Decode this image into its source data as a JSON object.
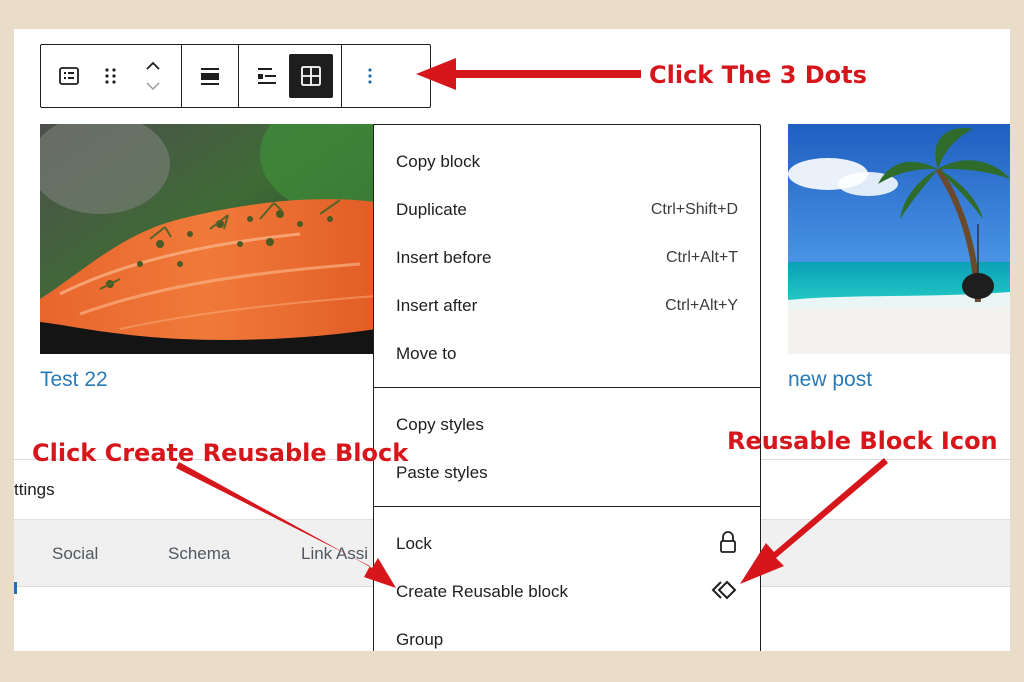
{
  "toolbar": {
    "buttons": [
      "block-type-icon",
      "drag-handle-icon",
      "move-up-down-icon",
      "align-icon",
      "list-view-icon",
      "grid-view-icon",
      "options-dots-icon"
    ]
  },
  "posts": [
    {
      "title": "Test 22"
    },
    {
      "title": "new post"
    }
  ],
  "menu": {
    "group1": [
      {
        "label": "Copy block",
        "shortcut": ""
      },
      {
        "label": "Duplicate",
        "shortcut": "Ctrl+Shift+D"
      },
      {
        "label": "Insert before",
        "shortcut": "Ctrl+Alt+T"
      },
      {
        "label": "Insert after",
        "shortcut": "Ctrl+Alt+Y"
      },
      {
        "label": "Move to",
        "shortcut": ""
      }
    ],
    "group2": [
      {
        "label": "Copy styles"
      },
      {
        "label": "Paste styles"
      }
    ],
    "group3": [
      {
        "label": "Lock",
        "icon": "lock-icon"
      },
      {
        "label": "Create Reusable block",
        "icon": "reusable-block-icon"
      },
      {
        "label": "Group"
      }
    ]
  },
  "settings": {
    "label": "ttings",
    "tabs": [
      "Social",
      "Schema",
      "Link Assi"
    ]
  },
  "annotations": {
    "click_dots": "Click The 3 Dots",
    "click_create": "Click Create Reusable Block",
    "reusable_icon": "Reusable Block Icon"
  },
  "colors": {
    "annotation": "#d6161b",
    "link": "#2a7ab5",
    "frame": "#e9dcc9",
    "active_button": "#1e1e1e"
  }
}
